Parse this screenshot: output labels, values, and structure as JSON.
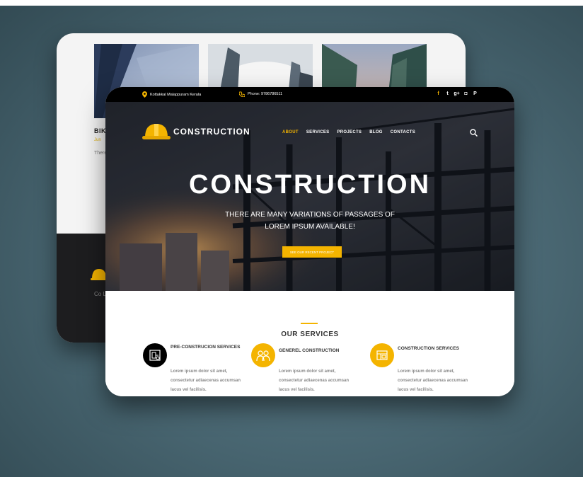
{
  "back": {
    "title": "BIK",
    "date": "Jun",
    "text": "There Lore have",
    "footer_text": "Co Lore rsre a n liter ma old."
  },
  "front": {
    "topbar": {
      "address": "Kottakkal Malappuram Kerala",
      "phone": "Phone: 9786786511"
    },
    "socials": [
      {
        "icon": "facebook-icon",
        "glyph": "f"
      },
      {
        "icon": "twitter-icon",
        "glyph": "t"
      },
      {
        "icon": "google-plus-icon",
        "glyph": "g+"
      },
      {
        "icon": "instagram-icon",
        "glyph": "◘"
      },
      {
        "icon": "pinterest-icon",
        "glyph": "P"
      }
    ],
    "logo_text": "CONSTRUCTION",
    "nav": [
      "ABOUT",
      "SERVICES",
      "PROJECTS",
      "BLOG",
      "CONTACTS"
    ],
    "nav_active": "ABOUT",
    "hero": {
      "title": "CONSTRUCTION",
      "subtitle": "THERE ARE MANY VARIATIONS OF PASSAGES OF LOREM IPSUM AVAILABLE!",
      "cta": "SEE OUR RECENT PROJECT"
    },
    "services": {
      "heading": "OUR SERVICES",
      "items": [
        {
          "title": "PRE-CONSTRUCION SERVICES",
          "desc": "Lorem ipsum dolor sit amet, consectetur adiaecenas accumsan lacus vel facilisis.",
          "icon": "blueprint-icon",
          "icon_bg": "#000000"
        },
        {
          "title": "GENEREL CONSTRUCTION",
          "desc": "Lorem ipsum dolor sit amet, consectetur adiaecenas accumsan lacus vel facilisis.",
          "icon": "workers-icon",
          "icon_bg": "#f4b400"
        },
        {
          "title": "CONSTRUCTION SERVICES",
          "desc": "Lorem ipsum dolor sit amet, consectetur adiaecenas accumsan lacus vel facilisis.",
          "icon": "plan-icon",
          "icon_bg": "#f4b400"
        }
      ]
    }
  },
  "colors": {
    "accent": "#f4b400",
    "dark": "#000000"
  }
}
